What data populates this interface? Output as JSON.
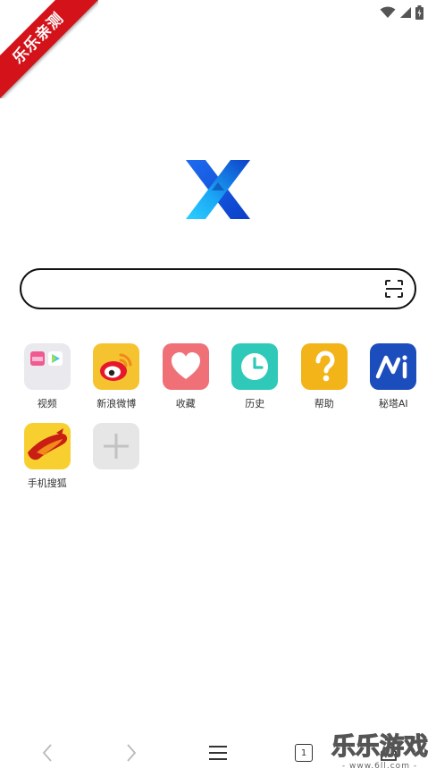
{
  "badge": {
    "text": "乐乐亲测"
  },
  "search": {
    "value": "",
    "placeholder": ""
  },
  "shortcuts": [
    {
      "label": "视频",
      "icon": "video-folder-icon"
    },
    {
      "label": "新浪微博",
      "icon": "weibo-icon"
    },
    {
      "label": "收藏",
      "icon": "heart-icon"
    },
    {
      "label": "历史",
      "icon": "clock-icon"
    },
    {
      "label": "帮助",
      "icon": "question-icon"
    },
    {
      "label": "秘塔AI",
      "icon": "metaso-icon"
    },
    {
      "label": "手机搜狐",
      "icon": "sohu-fox-icon"
    },
    {
      "label": "",
      "icon": "add-icon"
    }
  ],
  "toolbar": {
    "tab_count": "1"
  },
  "watermark": {
    "brand": "乐乐游戏",
    "url": "- www.6ll.com -"
  },
  "colors": {
    "weibo_bg": "#f5c330",
    "favorites_bg": "#f07078",
    "history_bg": "#2ec9b8",
    "help_bg": "#f2b418",
    "metaso_bg": "#1c4dbd",
    "sohu_bg": "#f7d030",
    "add_bg": "#e6e6e6",
    "badge_red": "#d3121a"
  }
}
